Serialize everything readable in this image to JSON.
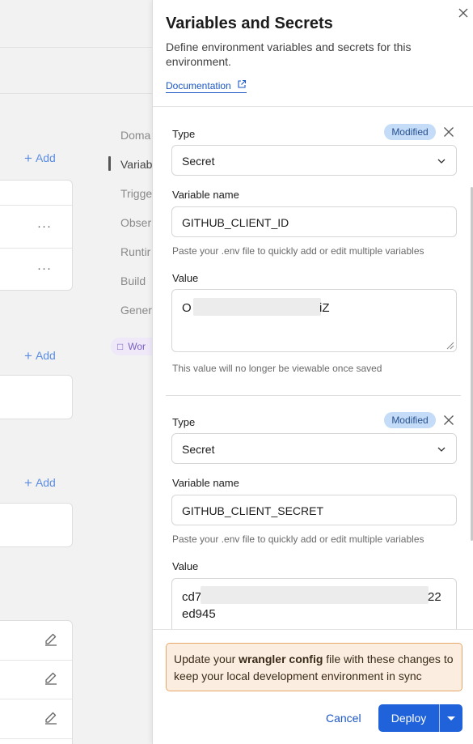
{
  "background": {
    "add_label": "Add",
    "nav_items": [
      "Doma",
      "Variab",
      "Trigge",
      "Obser",
      "Runtir",
      "Build",
      "Gener"
    ],
    "active_nav": "Variab",
    "pill_label": "Wor"
  },
  "drawer": {
    "title": "Variables and Secrets",
    "subtitle": "Define environment variables and secrets for this environment.",
    "documentation_link": "Documentation",
    "variables": [
      {
        "type_label": "Type",
        "badge": "Modified",
        "type_value": "Secret",
        "name_label": "Variable name",
        "name_value": "GITHUB_CLIENT_ID",
        "paste_hint": "Paste your .env file to quickly add or edit multiple variables",
        "value_label": "Value",
        "value_prefix": "O",
        "value_suffix": "iZ",
        "value_line2": "",
        "value_hint": "This value will no longer be viewable once saved"
      },
      {
        "type_label": "Type",
        "badge": "Modified",
        "type_value": "Secret",
        "name_label": "Variable name",
        "name_value": "GITHUB_CLIENT_SECRET",
        "paste_hint": "Paste your .env file to quickly add or edit multiple variables",
        "value_label": "Value",
        "value_prefix": "cd7",
        "value_suffix": "22",
        "value_line2": "ed945",
        "value_hint": ""
      }
    ],
    "notice": {
      "before": "Update your ",
      "bold": "wrangler config",
      "after": " file with these changes to keep your local development environment in sync"
    },
    "cancel_label": "Cancel",
    "deploy_label": "Deploy"
  },
  "colors": {
    "primary": "#1f62d9",
    "link": "#1a56c4",
    "badge_bg": "#c4dcf8",
    "notice_bg": "#fbeee0",
    "notice_border": "#e6a86a"
  }
}
